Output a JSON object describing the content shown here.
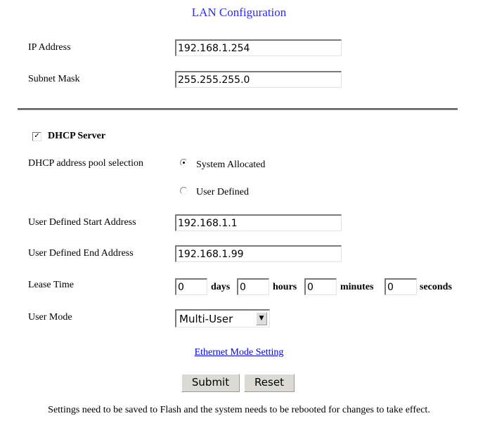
{
  "title": "LAN Configuration",
  "lan": {
    "ip_label": "IP Address",
    "ip_value": "192.168.1.254",
    "subnet_label": "Subnet Mask",
    "subnet_value": "255.255.255.0"
  },
  "dhcp": {
    "checkbox_label": "DHCP Server",
    "checked": true,
    "check_glyph": "✓",
    "pool_label": "DHCP address pool selection",
    "pool_options": [
      {
        "label": "System Allocated",
        "selected": true
      },
      {
        "label": "User Defined",
        "selected": false
      }
    ],
    "start_label": "User Defined Start Address",
    "start_value": "192.168.1.1",
    "end_label": "User Defined End Address",
    "end_value": "192.168.1.99",
    "lease_label": "Lease Time",
    "lease": {
      "days": "0",
      "days_label": "days",
      "hours": "0",
      "hours_label": "hours",
      "minutes": "0",
      "minutes_label": "minutes",
      "seconds": "0",
      "seconds_label": "seconds"
    },
    "mode_label": "User Mode",
    "mode_value": "Multi-User",
    "dropdown_glyph": "▼"
  },
  "link": "Ethernet Mode Setting",
  "buttons": {
    "submit": "Submit",
    "reset": "Reset"
  },
  "note": "Settings need to be saved to Flash and the system needs to be rebooted for changes to take effect."
}
